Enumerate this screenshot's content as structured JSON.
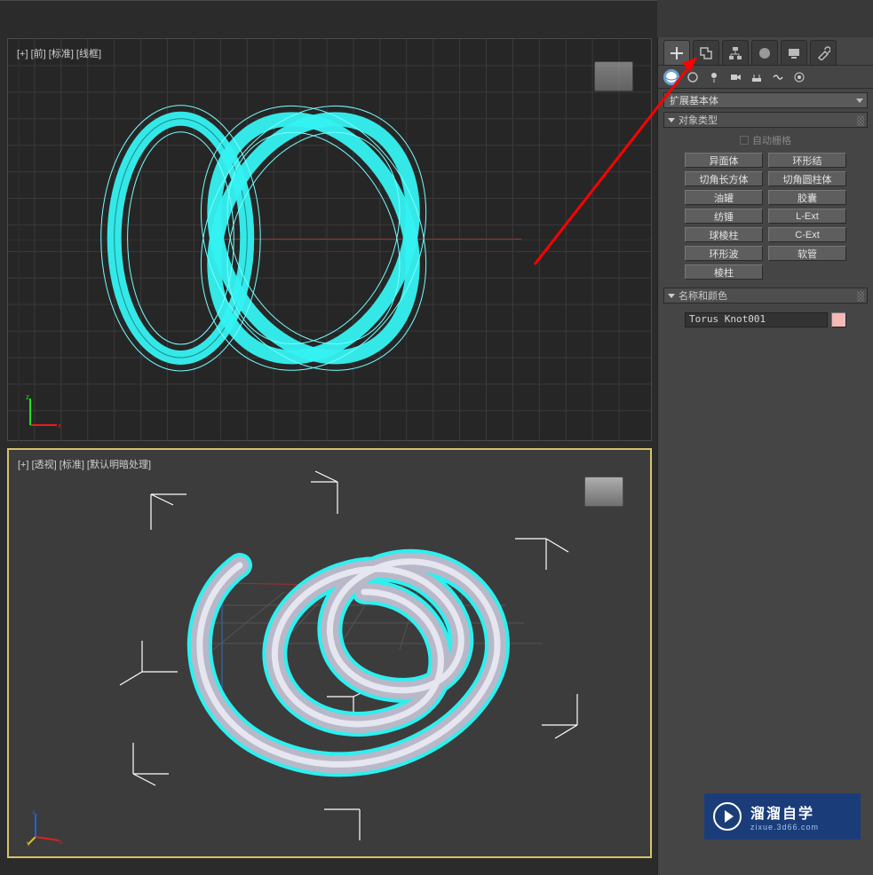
{
  "viewports": {
    "top_label": "[+] [前] [标准] [线框]",
    "bottom_label": "[+] [透视] [标准] [默认明暗处理]"
  },
  "panel": {
    "tabs": {
      "create": "create-tab",
      "modify": "modify-tab",
      "hierarchy": "hierarchy-tab",
      "motion": "motion-tab",
      "display": "display-tab",
      "utilities": "utilities-tab"
    },
    "category_dropdown": "扩展基本体",
    "object_type_header": "对象类型",
    "autogrid_label": "自动栅格",
    "types": [
      "异面体",
      "环形结",
      "切角长方体",
      "切角圆柱体",
      "油罐",
      "胶囊",
      "纺锤",
      "L-Ext",
      "球棱柱",
      "C-Ext",
      "环形波",
      "软管",
      "棱柱"
    ],
    "name_color_header": "名称和颜色",
    "object_name": "Torus Knot001",
    "object_color": "#f2b9b7"
  },
  "watermark": {
    "line1": "溜溜自学",
    "line2": "zixue.3d66.com"
  }
}
